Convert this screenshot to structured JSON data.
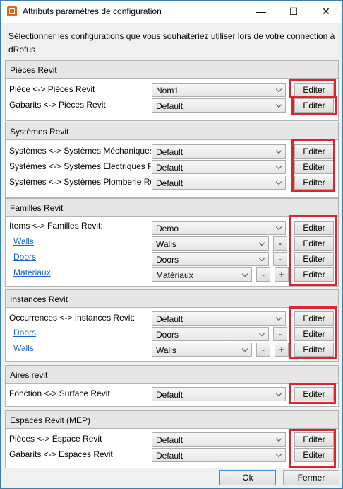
{
  "window": {
    "title": "Attributs paramètres de configuration",
    "minimize": "—",
    "maximize": "☐",
    "close": "✕"
  },
  "intro": "Sélectionner les configurations que vous souhaiteriez utiliser lors de votre connection à dRofus",
  "colors": {
    "highlight": "#e3232b",
    "link": "#1a64c8",
    "group_header": "#e6e6e6"
  },
  "groups": {
    "pieces": {
      "title": "Pièces Revit",
      "rows": [
        {
          "label": "Pièce <-> Pièces Revit",
          "value": "Nom1",
          "button": "Editer"
        },
        {
          "label": "Gabarits <-> Pièces Revit",
          "value": "Default",
          "button": "Editer"
        }
      ]
    },
    "systemes": {
      "title": "Systèmes Revit",
      "rows": [
        {
          "label": "Systèmes <-> Systèmes Méchaniques Revit",
          "value": "Default",
          "button": "Editer"
        },
        {
          "label": "Systèmes <-> Systèmes Electriques Revit",
          "value": "Default",
          "button": "Editer"
        },
        {
          "label": "Systèmes <-> Systèmes Plomberie Revit",
          "value": "Default",
          "button": "Editer"
        }
      ]
    },
    "familles": {
      "title": "Familles Revit",
      "rows": [
        {
          "label": "Items <-> Familles Revit:",
          "value": "Demo",
          "button": "Editer"
        },
        {
          "label": "Walls",
          "value": "Walls",
          "minus": "-",
          "button": "Editer"
        },
        {
          "label": "Doors",
          "value": "Doors",
          "minus": "-",
          "button": "Editer"
        },
        {
          "label": "Matériaux",
          "value": "Matériaux",
          "minus": "-",
          "plus": "+",
          "button": "Editer"
        }
      ]
    },
    "instances": {
      "title": "Instances Revit",
      "rows": [
        {
          "label": "Occurrences <-> Instances Revit:",
          "value": "Default",
          "button": "Editer"
        },
        {
          "label": "Doors",
          "value": "Doors",
          "minus": "-",
          "button": "Editer"
        },
        {
          "label": "Walls",
          "value": "Walls",
          "minus": "-",
          "plus": "+",
          "button": "Editer"
        }
      ]
    },
    "aires": {
      "title": "Aires revit",
      "rows": [
        {
          "label": "Fonction <-> Surface Revit",
          "value": "Default",
          "button": "Editer"
        }
      ]
    },
    "espaces": {
      "title": "Espaces Revit (MEP)",
      "rows": [
        {
          "label": "Pièces <-> Espace Revit",
          "value": "Default",
          "button": "Editer"
        },
        {
          "label": "Gabarits <-> Espaces Revit",
          "value": "Default",
          "button": "Editer"
        }
      ]
    }
  },
  "footer": {
    "ok": "Ok",
    "close": "Fermer"
  }
}
